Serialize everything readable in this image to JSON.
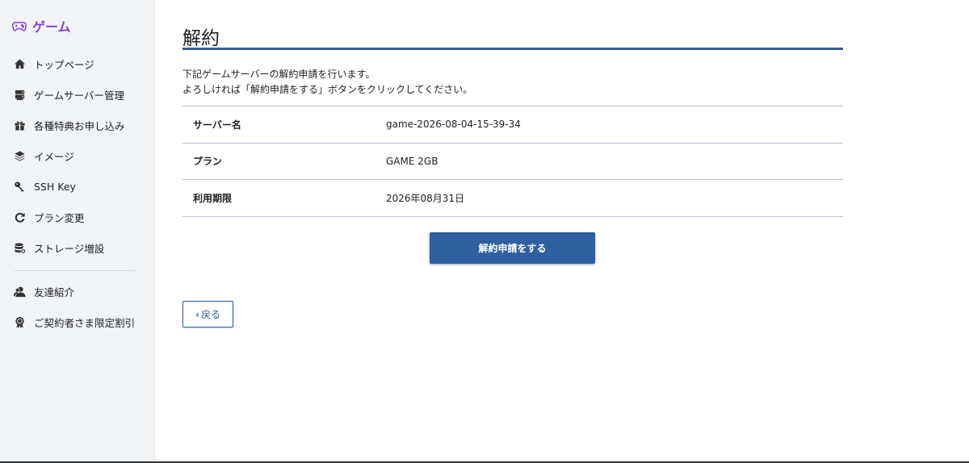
{
  "brand": {
    "label": "ゲーム",
    "color": "#8a3fd0",
    "icon": "gamepad-icon"
  },
  "sidebar": {
    "items": [
      {
        "label": "トップページ",
        "icon": "home-icon"
      },
      {
        "label": "ゲームサーバー管理",
        "icon": "server-icon"
      },
      {
        "label": "各種特典お申し込み",
        "icon": "gift-icon"
      },
      {
        "label": "イメージ",
        "icon": "layers-icon"
      },
      {
        "label": "SSH Key",
        "icon": "key-icon"
      },
      {
        "label": "プラン変更",
        "icon": "refresh-icon"
      },
      {
        "label": "ストレージ増設",
        "icon": "storage-icon"
      }
    ],
    "items_bottom": [
      {
        "label": "友達紹介",
        "icon": "users-icon"
      },
      {
        "label": "ご契約者さま限定割引",
        "icon": "badge-icon"
      }
    ]
  },
  "main": {
    "title": "解約",
    "desc_line1": "下記ゲームサーバーの解約申請を行います。",
    "desc_line2": "よろしければ「解約申請をする」ボタンをクリックしてください。",
    "rows": [
      {
        "key": "サーバー名",
        "value": "game-2026-08-04-15-39-34"
      },
      {
        "key": "プラン",
        "value": "GAME 2GB"
      },
      {
        "key": "利用期限",
        "value": "2026年08月31日"
      }
    ],
    "submit_label": "解約申請をする",
    "back_label": "戻る",
    "accent": "#2d5fa1"
  }
}
